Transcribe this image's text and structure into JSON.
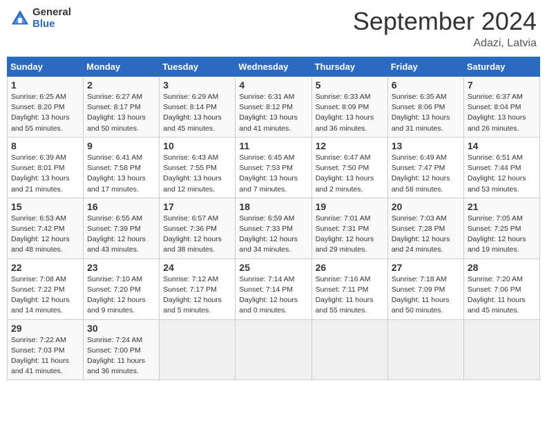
{
  "header": {
    "logo_general": "General",
    "logo_blue": "Blue",
    "month_title": "September 2024",
    "location": "Adazi, Latvia"
  },
  "calendar": {
    "days_of_week": [
      "Sunday",
      "Monday",
      "Tuesday",
      "Wednesday",
      "Thursday",
      "Friday",
      "Saturday"
    ],
    "weeks": [
      [
        {
          "day": "1",
          "info": "Sunrise: 6:25 AM\nSunset: 8:20 PM\nDaylight: 13 hours\nand 55 minutes."
        },
        {
          "day": "2",
          "info": "Sunrise: 6:27 AM\nSunset: 8:17 PM\nDaylight: 13 hours\nand 50 minutes."
        },
        {
          "day": "3",
          "info": "Sunrise: 6:29 AM\nSunset: 8:14 PM\nDaylight: 13 hours\nand 45 minutes."
        },
        {
          "day": "4",
          "info": "Sunrise: 6:31 AM\nSunset: 8:12 PM\nDaylight: 13 hours\nand 41 minutes."
        },
        {
          "day": "5",
          "info": "Sunrise: 6:33 AM\nSunset: 8:09 PM\nDaylight: 13 hours\nand 36 minutes."
        },
        {
          "day": "6",
          "info": "Sunrise: 6:35 AM\nSunset: 8:06 PM\nDaylight: 13 hours\nand 31 minutes."
        },
        {
          "day": "7",
          "info": "Sunrise: 6:37 AM\nSunset: 8:04 PM\nDaylight: 13 hours\nand 26 minutes."
        }
      ],
      [
        {
          "day": "8",
          "info": "Sunrise: 6:39 AM\nSunset: 8:01 PM\nDaylight: 13 hours\nand 21 minutes."
        },
        {
          "day": "9",
          "info": "Sunrise: 6:41 AM\nSunset: 7:58 PM\nDaylight: 13 hours\nand 17 minutes."
        },
        {
          "day": "10",
          "info": "Sunrise: 6:43 AM\nSunset: 7:55 PM\nDaylight: 13 hours\nand 12 minutes."
        },
        {
          "day": "11",
          "info": "Sunrise: 6:45 AM\nSunset: 7:53 PM\nDaylight: 13 hours\nand 7 minutes."
        },
        {
          "day": "12",
          "info": "Sunrise: 6:47 AM\nSunset: 7:50 PM\nDaylight: 13 hours\nand 2 minutes."
        },
        {
          "day": "13",
          "info": "Sunrise: 6:49 AM\nSunset: 7:47 PM\nDaylight: 12 hours\nand 58 minutes."
        },
        {
          "day": "14",
          "info": "Sunrise: 6:51 AM\nSunset: 7:44 PM\nDaylight: 12 hours\nand 53 minutes."
        }
      ],
      [
        {
          "day": "15",
          "info": "Sunrise: 6:53 AM\nSunset: 7:42 PM\nDaylight: 12 hours\nand 48 minutes."
        },
        {
          "day": "16",
          "info": "Sunrise: 6:55 AM\nSunset: 7:39 PM\nDaylight: 12 hours\nand 43 minutes."
        },
        {
          "day": "17",
          "info": "Sunrise: 6:57 AM\nSunset: 7:36 PM\nDaylight: 12 hours\nand 38 minutes."
        },
        {
          "day": "18",
          "info": "Sunrise: 6:59 AM\nSunset: 7:33 PM\nDaylight: 12 hours\nand 34 minutes."
        },
        {
          "day": "19",
          "info": "Sunrise: 7:01 AM\nSunset: 7:31 PM\nDaylight: 12 hours\nand 29 minutes."
        },
        {
          "day": "20",
          "info": "Sunrise: 7:03 AM\nSunset: 7:28 PM\nDaylight: 12 hours\nand 24 minutes."
        },
        {
          "day": "21",
          "info": "Sunrise: 7:05 AM\nSunset: 7:25 PM\nDaylight: 12 hours\nand 19 minutes."
        }
      ],
      [
        {
          "day": "22",
          "info": "Sunrise: 7:08 AM\nSunset: 7:22 PM\nDaylight: 12 hours\nand 14 minutes."
        },
        {
          "day": "23",
          "info": "Sunrise: 7:10 AM\nSunset: 7:20 PM\nDaylight: 12 hours\nand 9 minutes."
        },
        {
          "day": "24",
          "info": "Sunrise: 7:12 AM\nSunset: 7:17 PM\nDaylight: 12 hours\nand 5 minutes."
        },
        {
          "day": "25",
          "info": "Sunrise: 7:14 AM\nSunset: 7:14 PM\nDaylight: 12 hours\nand 0 minutes."
        },
        {
          "day": "26",
          "info": "Sunrise: 7:16 AM\nSunset: 7:11 PM\nDaylight: 11 hours\nand 55 minutes."
        },
        {
          "day": "27",
          "info": "Sunrise: 7:18 AM\nSunset: 7:09 PM\nDaylight: 11 hours\nand 50 minutes."
        },
        {
          "day": "28",
          "info": "Sunrise: 7:20 AM\nSunset: 7:06 PM\nDaylight: 11 hours\nand 45 minutes."
        }
      ],
      [
        {
          "day": "29",
          "info": "Sunrise: 7:22 AM\nSunset: 7:03 PM\nDaylight: 11 hours\nand 41 minutes."
        },
        {
          "day": "30",
          "info": "Sunrise: 7:24 AM\nSunset: 7:00 PM\nDaylight: 11 hours\nand 36 minutes."
        },
        {
          "day": "",
          "info": ""
        },
        {
          "day": "",
          "info": ""
        },
        {
          "day": "",
          "info": ""
        },
        {
          "day": "",
          "info": ""
        },
        {
          "day": "",
          "info": ""
        }
      ]
    ]
  }
}
